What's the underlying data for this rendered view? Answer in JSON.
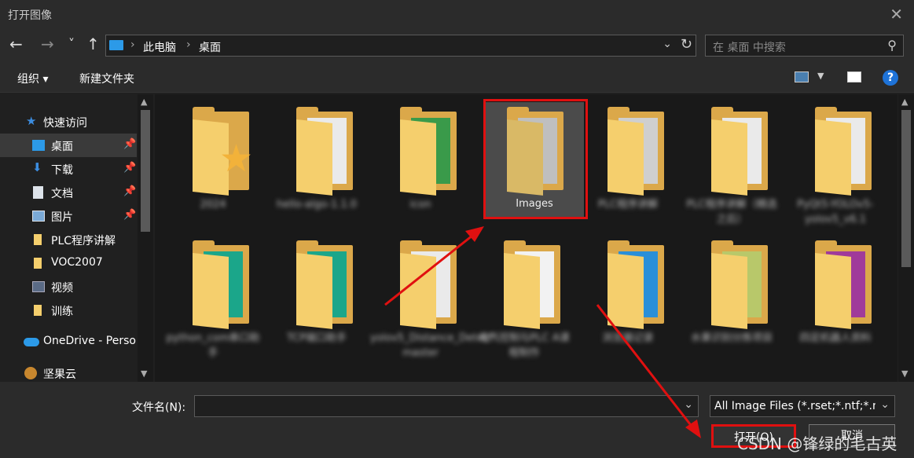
{
  "window": {
    "title": "打开图像"
  },
  "nav": {
    "back": "←",
    "forward": "→",
    "recent": "˅",
    "up": "↑",
    "breadcrumbs": [
      "此电脑",
      "桌面"
    ],
    "search_placeholder": "在 桌面 中搜索"
  },
  "toolbar": {
    "organize": "组织 ▾",
    "new_folder": "新建文件夹",
    "help": "?"
  },
  "sidebar": {
    "items": [
      {
        "label": "快速访问",
        "icon": "star-icon",
        "pinned": false
      },
      {
        "label": "桌面",
        "icon": "desktop-icon",
        "pinned": true,
        "selected": true
      },
      {
        "label": "下载",
        "icon": "download-icon",
        "pinned": true
      },
      {
        "label": "文档",
        "icon": "document-icon",
        "pinned": true
      },
      {
        "label": "图片",
        "icon": "picture-icon",
        "pinned": true
      },
      {
        "label": "PLC程序讲解",
        "icon": "folder-icon",
        "pinned": false
      },
      {
        "label": "VOC2007",
        "icon": "folder-icon",
        "pinned": false
      },
      {
        "label": "视频",
        "icon": "video-icon",
        "pinned": false
      },
      {
        "label": "训练",
        "icon": "folder-icon",
        "pinned": false
      },
      {
        "label": "OneDrive - Perso",
        "icon": "cloud-icon",
        "pinned": false
      },
      {
        "label": "坚果云",
        "icon": "nut-icon",
        "pinned": false
      }
    ]
  },
  "files": [
    {
      "label": "2024",
      "blurred": true,
      "kind": "folder-star"
    },
    {
      "label": "hello-algo-1.1.0",
      "blurred": true,
      "kind": "folder"
    },
    {
      "label": "icon",
      "blurred": true,
      "kind": "folder"
    },
    {
      "label": "Images",
      "blurred": false,
      "kind": "folder",
      "selected": true
    },
    {
      "label": "PLC程序讲解",
      "blurred": true,
      "kind": "folder"
    },
    {
      "label": "PLC程序讲解（精选之后）",
      "blurred": true,
      "kind": "folder"
    },
    {
      "label": "PyQt5-YOLOv5-yolov5_v6.1",
      "blurred": true,
      "kind": "folder"
    },
    {
      "label": "python_com串口助手",
      "blurred": true,
      "kind": "folder"
    },
    {
      "label": "TCP端口助手",
      "blurred": true,
      "kind": "folder"
    },
    {
      "label": "yolov5_Distance_Detect-master",
      "blurred": true,
      "kind": "folder"
    },
    {
      "label": "电气控制与PLC A课程制作",
      "blurred": true,
      "kind": "folder"
    },
    {
      "label": "浏览器记录",
      "blurred": true,
      "kind": "folder"
    },
    {
      "label": "水果识别分拣项目",
      "blurred": true,
      "kind": "folder"
    },
    {
      "label": "四足机器人资料",
      "blurred": true,
      "kind": "folder"
    }
  ],
  "footer": {
    "filename_label": "文件名(N):",
    "filename_value": "",
    "filter": "All Image Files (*.rset;*.ntf;*.n",
    "open": "打开(O)",
    "cancel": "取消"
  },
  "watermark": "CSDN @锋绿的毛古英",
  "colors": {
    "accent": "#2c9ae8",
    "highlight": "#e01010",
    "folder": "#f5cf6d"
  }
}
